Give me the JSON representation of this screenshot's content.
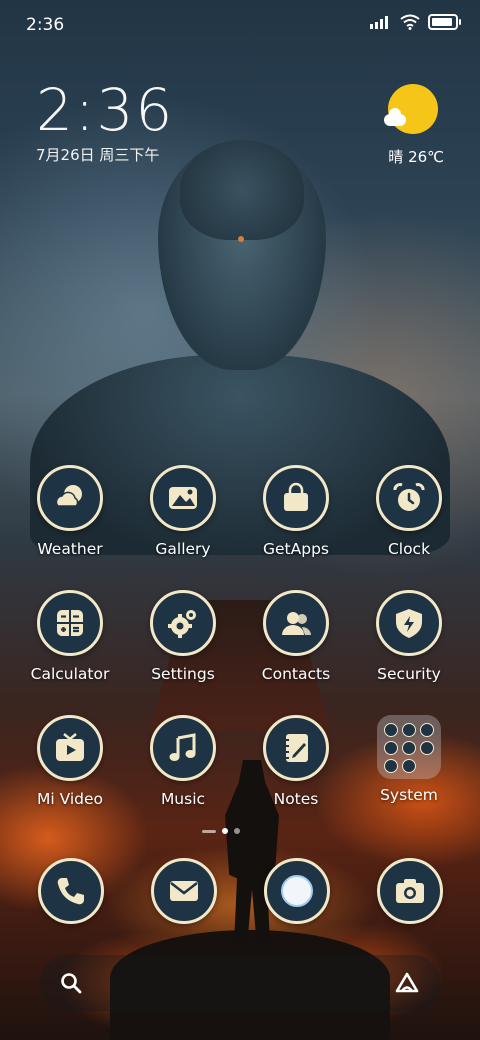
{
  "status_bar": {
    "time": "2:36",
    "icons": [
      "signal-icon",
      "wifi-icon",
      "battery-icon"
    ],
    "battery_level": 0.9
  },
  "clock_widget": {
    "time": "2:36",
    "date": "7月26日 周三下午"
  },
  "weather_widget": {
    "icon": "sunny-partly-cloudy-icon",
    "text": "晴 26℃"
  },
  "apps": [
    {
      "label": "Weather",
      "icon": "weather-icon"
    },
    {
      "label": "Gallery",
      "icon": "gallery-icon"
    },
    {
      "label": "GetApps",
      "icon": "shopping-bag-icon"
    },
    {
      "label": "Clock",
      "icon": "alarm-clock-icon"
    },
    {
      "label": "Calculator",
      "icon": "calculator-icon"
    },
    {
      "label": "Settings",
      "icon": "gear-icon"
    },
    {
      "label": "Contacts",
      "icon": "contacts-icon"
    },
    {
      "label": "Security",
      "icon": "shield-icon"
    },
    {
      "label": "Mi Video",
      "icon": "tv-play-icon"
    },
    {
      "label": "Music",
      "icon": "music-note-icon"
    },
    {
      "label": "Notes",
      "icon": "notebook-icon"
    },
    {
      "label": "System",
      "icon": "folder-icon"
    }
  ],
  "page_indicator": {
    "pages": 2,
    "current": 1
  },
  "dock": [
    {
      "icon": "phone-icon",
      "app": "Phone"
    },
    {
      "icon": "mail-icon",
      "app": "Messages"
    },
    {
      "icon": "browser-icon",
      "app": "Browser"
    },
    {
      "icon": "camera-icon",
      "app": "Camera"
    }
  ],
  "search_bar": {
    "left_icon": "search-icon",
    "right_icon": "assistant-icon"
  },
  "colors": {
    "icon_fill": "#1e3444",
    "icon_glyph": "#f2e8c8",
    "sun": "#f5c518"
  }
}
